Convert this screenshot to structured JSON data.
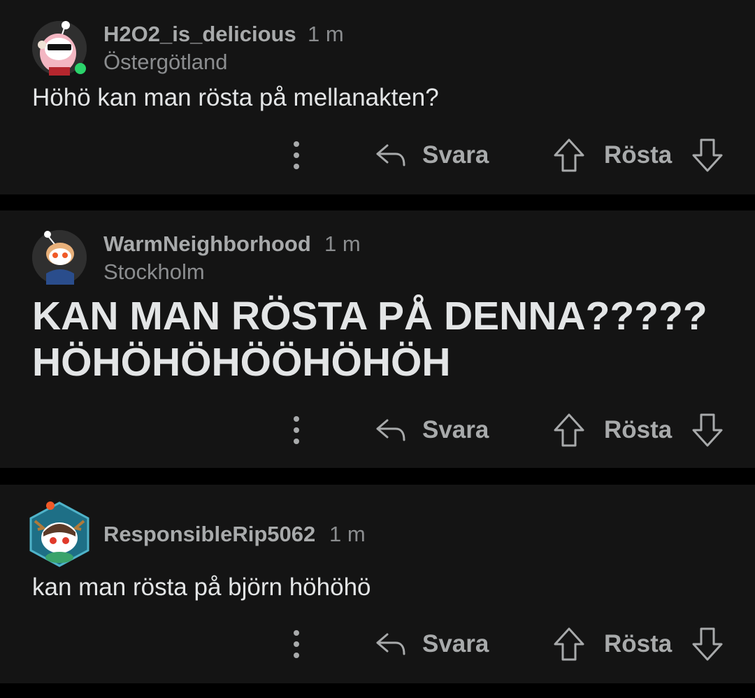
{
  "comments": [
    {
      "username": "H2O2_is_delicious",
      "time": "1 m",
      "flair": "Östergötland",
      "body": "Höhö kan man rösta på mellanakten?",
      "online": true,
      "reply_label": "Svara",
      "vote_label": "Rösta"
    },
    {
      "username": "WarmNeighborhood",
      "time": "1 m",
      "flair": "Stockholm",
      "body_lines": [
        "KAN MAN RÖSTA PÅ DENNA?????",
        "HÖHÖHÖHÖÖHÖHÖH"
      ],
      "reply_label": "Svara",
      "vote_label": "Rösta"
    },
    {
      "username": "ResponsibleRip5062",
      "time": "1 m",
      "body": "kan man rösta på björn höhöhö",
      "reply_label": "Svara",
      "vote_label": "Rösta"
    }
  ],
  "colors": {
    "background": "#000000",
    "card": "#141414",
    "online": "#2bd36b",
    "text": "#e3e5e6",
    "meta": "#8b8d8f"
  }
}
